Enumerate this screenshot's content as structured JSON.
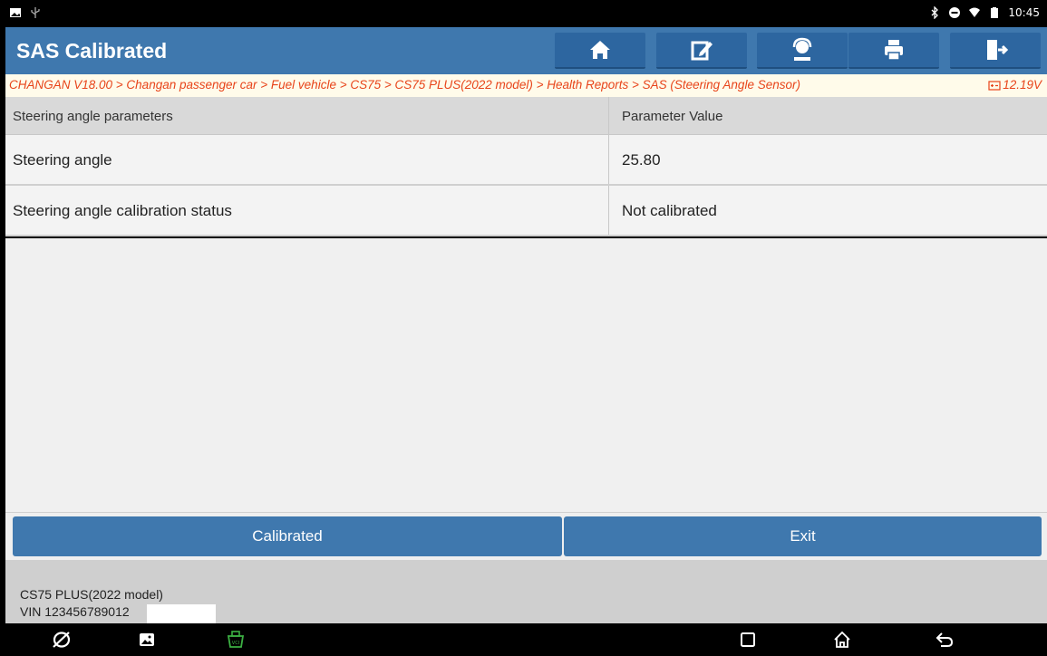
{
  "status_bar": {
    "time": "10:45",
    "left_icons": [
      "image-icon",
      "usb-icon"
    ],
    "right_icons": [
      "bluetooth-icon",
      "minus-circle-icon",
      "wifi-icon",
      "battery-icon"
    ]
  },
  "header": {
    "title": "SAS Calibrated",
    "toolbar": [
      "home-icon",
      "edit-icon",
      "support-icon",
      "print-icon",
      "exit-icon"
    ]
  },
  "breadcrumb": {
    "path": "CHANGAN V18.00 > Changan passenger car > Fuel vehicle > CS75 > CS75 PLUS(2022 model) > Health Reports > SAS (Steering Angle Sensor)",
    "voltage": "12.19V"
  },
  "table": {
    "headers": [
      "Steering angle parameters",
      "Parameter Value"
    ],
    "rows": [
      {
        "name": "Steering angle",
        "value": "25.80"
      },
      {
        "name": "Steering angle calibration status",
        "value": "Not calibrated"
      }
    ]
  },
  "actions": {
    "calibrated_label": "Calibrated",
    "exit_label": "Exit"
  },
  "footer": {
    "model": "CS75 PLUS(2022 model)",
    "vin": "VIN 123456789012"
  },
  "nav_bar": [
    "browser-icon",
    "gallery-icon",
    "vci-icon",
    "recents-icon",
    "home-icon",
    "back-icon"
  ],
  "colors": {
    "header_blue": "#3f78ae",
    "breadcrumb_text": "#e8441a",
    "vci_green": "#3cb043"
  }
}
